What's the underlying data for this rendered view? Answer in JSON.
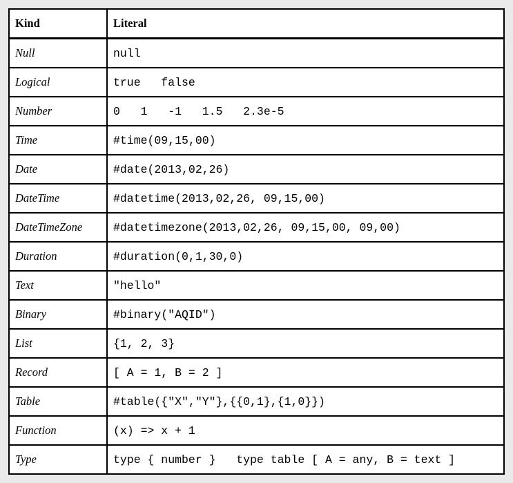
{
  "table": {
    "headers": {
      "kind": "Kind",
      "literal": "Literal"
    },
    "rows": [
      {
        "kind": "Null",
        "literal": "null"
      },
      {
        "kind": "Logical",
        "literal": "true   false"
      },
      {
        "kind": "Number",
        "literal": "0   1   -1   1.5   2.3e-5"
      },
      {
        "kind": "Time",
        "literal": "#time(09,15,00)"
      },
      {
        "kind": "Date",
        "literal": "#date(2013,02,26)"
      },
      {
        "kind": "DateTime",
        "literal": "#datetime(2013,02,26, 09,15,00)"
      },
      {
        "kind": "DateTimeZone",
        "literal": "#datetimezone(2013,02,26, 09,15,00, 09,00)"
      },
      {
        "kind": "Duration",
        "literal": "#duration(0,1,30,0)"
      },
      {
        "kind": "Text",
        "literal": "\"hello\""
      },
      {
        "kind": "Binary",
        "literal": "#binary(\"AQID\")"
      },
      {
        "kind": "List",
        "literal": "{1, 2, 3}"
      },
      {
        "kind": "Record",
        "literal": "[ A = 1, B = 2 ]"
      },
      {
        "kind": "Table",
        "literal": "#table({\"X\",\"Y\"},{{0,1},{1,0}})"
      },
      {
        "kind": "Function",
        "literal": "(x) => x + 1"
      },
      {
        "kind": "Type",
        "literal": "type { number }   type table [ A = any, B = text ]"
      }
    ]
  }
}
